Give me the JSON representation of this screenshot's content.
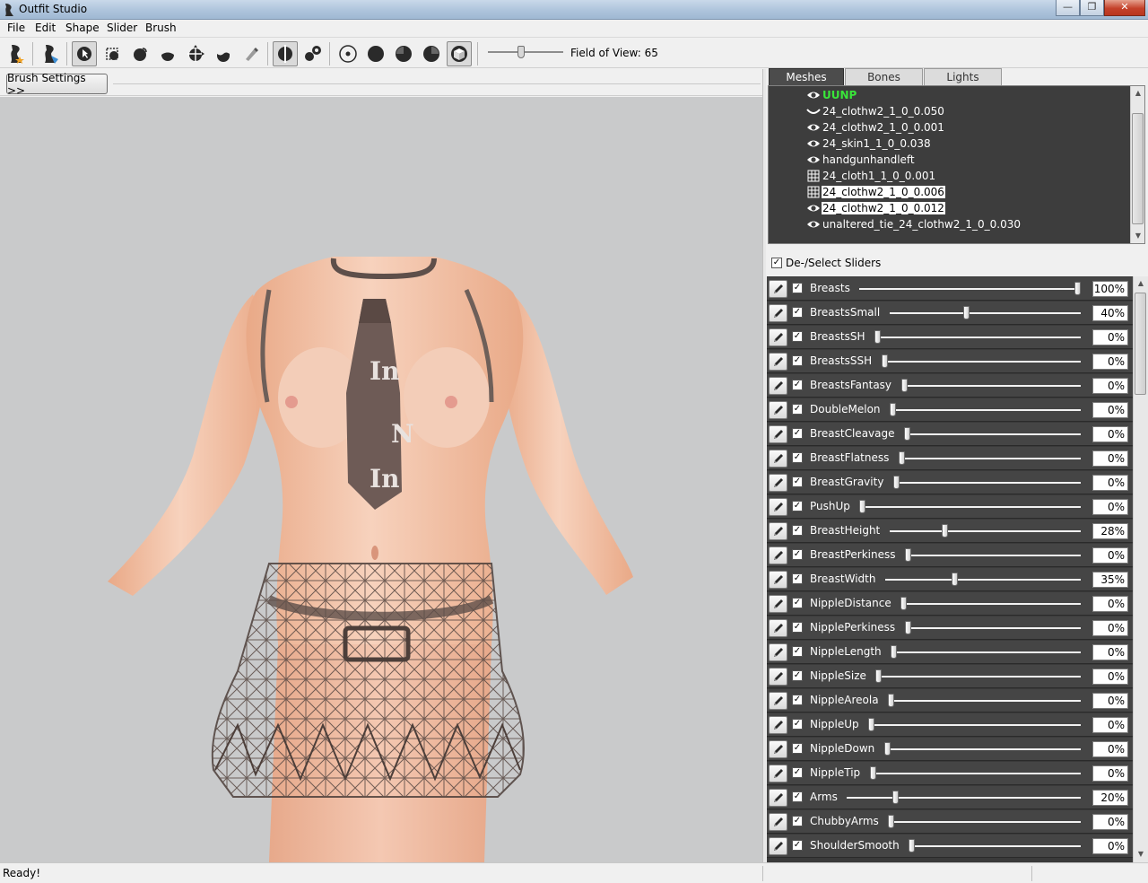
{
  "window": {
    "title": "Outfit Studio",
    "controls": [
      "—",
      "❐",
      "✕"
    ]
  },
  "menu": [
    "File",
    "Edit",
    "Shape",
    "Slider",
    "Brush"
  ],
  "toolbar": {
    "fov_label": "Field of View: 65",
    "fov_value": 65,
    "tools": [
      {
        "name": "load-reference-icon"
      },
      {
        "name": "load-outfit-icon"
      },
      {
        "name": "select-tool-icon",
        "pressed": true
      },
      {
        "name": "mask-tool-icon"
      },
      {
        "name": "inflate-tool-icon"
      },
      {
        "name": "deflate-tool-icon"
      },
      {
        "name": "move-tool-icon"
      },
      {
        "name": "smooth-tool-icon"
      },
      {
        "name": "weight-tool-icon"
      },
      {
        "name": "xmirror-icon",
        "pressed": true
      },
      {
        "name": "connected-only-icon"
      },
      {
        "name": "vertex-dot-icon"
      },
      {
        "name": "solid-circle-icon"
      },
      {
        "name": "half-circle-icon"
      },
      {
        "name": "half-circle-right-icon"
      },
      {
        "name": "cube-icon",
        "pressed": true
      }
    ]
  },
  "brush_settings": {
    "label": "Brush Settings >>"
  },
  "tabs": [
    {
      "label": "Meshes",
      "active": true
    },
    {
      "label": "Bones",
      "active": false
    },
    {
      "label": "Lights",
      "active": false
    }
  ],
  "meshes": [
    {
      "label": "UUNP",
      "icon": "eye-icon",
      "type": "reference"
    },
    {
      "label": "24_clothw2_1_0_0.050",
      "icon": "closed-eye-icon",
      "type": "normal"
    },
    {
      "label": "24_clothw2_1_0_0.001",
      "icon": "eye-icon",
      "type": "normal"
    },
    {
      "label": "24_skin1_1_0_0.038",
      "icon": "eye-icon",
      "type": "normal"
    },
    {
      "label": "handgunhandleft",
      "icon": "eye-icon",
      "type": "normal"
    },
    {
      "label": "24_cloth1_1_0_0.001",
      "icon": "wireframe-icon",
      "type": "normal"
    },
    {
      "label": "24_clothw2_1_0_0.006",
      "icon": "wireframe-icon",
      "type": "selected"
    },
    {
      "label": "24_clothw2_1_0_0.012",
      "icon": "eye-icon",
      "type": "selected"
    },
    {
      "label": "unaltered_tie_24_clothw2_1_0_0.030",
      "icon": "eye-icon",
      "type": "normal"
    }
  ],
  "deselect_sliders": {
    "label": "De-/Select Sliders",
    "checked": true
  },
  "sliders": [
    {
      "name": "Breasts",
      "value": 100,
      "display": "100%"
    },
    {
      "name": "BreastsSmall",
      "value": 40,
      "display": "40%"
    },
    {
      "name": "BreastsSH",
      "value": 0,
      "display": "0%"
    },
    {
      "name": "BreastsSSH",
      "value": 0,
      "display": "0%"
    },
    {
      "name": "BreastsFantasy",
      "value": 0,
      "display": "0%"
    },
    {
      "name": "DoubleMelon",
      "value": 0,
      "display": "0%"
    },
    {
      "name": "BreastCleavage",
      "value": 0,
      "display": "0%"
    },
    {
      "name": "BreastFlatness",
      "value": 0,
      "display": "0%"
    },
    {
      "name": "BreastGravity",
      "value": 0,
      "display": "0%"
    },
    {
      "name": "PushUp",
      "value": 0,
      "display": "0%"
    },
    {
      "name": "BreastHeight",
      "value": 28,
      "display": "28%"
    },
    {
      "name": "BreastPerkiness",
      "value": 0,
      "display": "0%"
    },
    {
      "name": "BreastWidth",
      "value": 35,
      "display": "35%"
    },
    {
      "name": "NippleDistance",
      "value": 0,
      "display": "0%"
    },
    {
      "name": "NipplePerkiness",
      "value": 0,
      "display": "0%"
    },
    {
      "name": "NippleLength",
      "value": 0,
      "display": "0%"
    },
    {
      "name": "NippleSize",
      "value": 0,
      "display": "0%"
    },
    {
      "name": "NippleAreola",
      "value": 0,
      "display": "0%"
    },
    {
      "name": "NippleUp",
      "value": 0,
      "display": "0%"
    },
    {
      "name": "NippleDown",
      "value": 0,
      "display": "0%"
    },
    {
      "name": "NippleTip",
      "value": 0,
      "display": "0%"
    },
    {
      "name": "Arms",
      "value": 20,
      "display": "20%"
    },
    {
      "name": "ChubbyArms",
      "value": 0,
      "display": "0%"
    },
    {
      "name": "ShoulderSmooth",
      "value": 0,
      "display": "0%"
    }
  ],
  "status": {
    "text": "Ready!"
  },
  "colors": {
    "viewport_bg": "#c9cacb",
    "panel_dark": "#454545",
    "reference_mesh": "#39e639",
    "skin": "#f2c2a6"
  }
}
